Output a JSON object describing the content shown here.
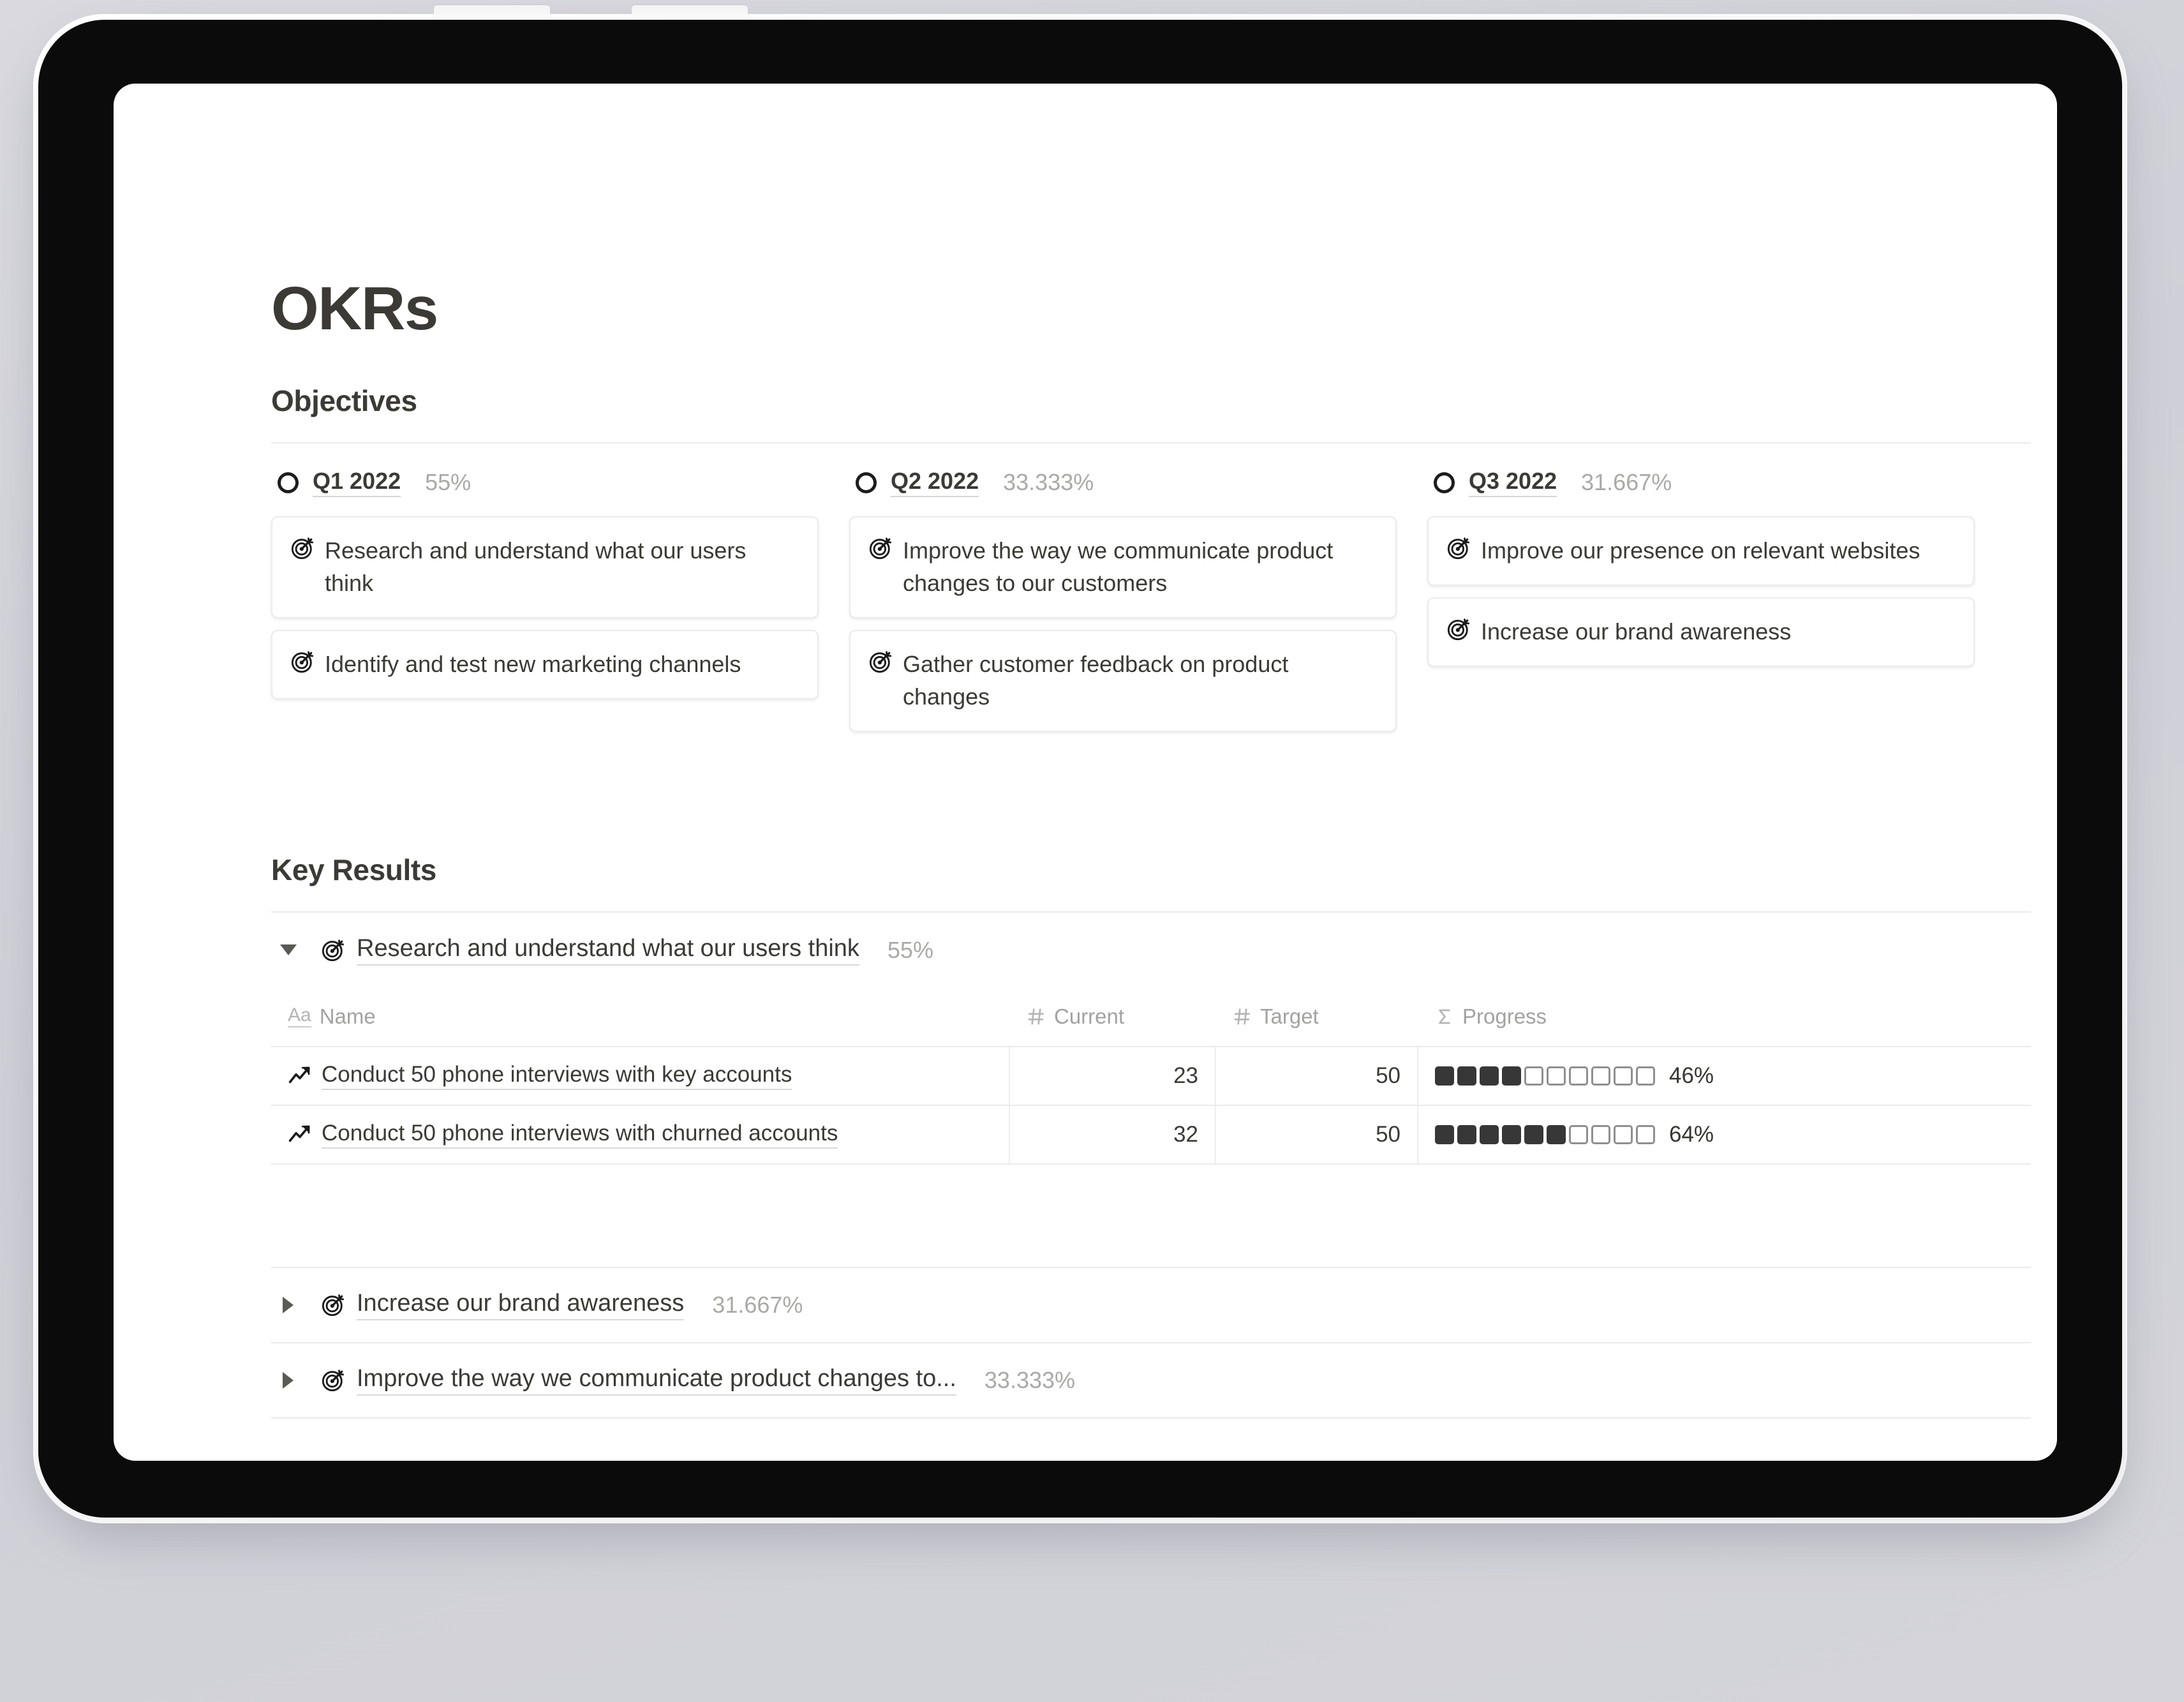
{
  "device": {
    "type": "tablet-mockup",
    "frame_color": "#f7f7f8",
    "bezel_color": "#0b0b0c",
    "screen_color": "#ffffff",
    "buttons": [
      "volume-up",
      "volume-down"
    ]
  },
  "page": {
    "title": "OKRs",
    "accent_text_color": "#3b3a35",
    "muted_text_color": "#a9a9a6",
    "divider_color": "#ebebeb"
  },
  "objectives": {
    "heading": "Objectives",
    "columns": [
      {
        "status_icon": "circle-icon",
        "name": "Q1 2022",
        "percent": "55%",
        "cards": [
          {
            "icon": "target-icon",
            "text": "Research and understand what our users think"
          },
          {
            "icon": "target-icon",
            "text": "Identify and test new marketing channels"
          }
        ]
      },
      {
        "status_icon": "circle-icon",
        "name": "Q2 2022",
        "percent": "33.333%",
        "cards": [
          {
            "icon": "target-icon",
            "text": "Improve the way we communicate product changes to our customers"
          },
          {
            "icon": "target-icon",
            "text": "Gather customer feedback on product changes"
          }
        ]
      },
      {
        "status_icon": "circle-icon",
        "name": "Q3 2022",
        "percent": "31.667%",
        "cards": [
          {
            "icon": "target-icon",
            "text": "Improve our presence on relevant websites"
          },
          {
            "icon": "target-icon",
            "text": "Increase our brand awareness"
          }
        ]
      }
    ]
  },
  "key_results": {
    "heading": "Key Results",
    "columns": [
      {
        "label": "Name",
        "type_icon": "text-type-icon"
      },
      {
        "label": "Current",
        "type_icon": "number-type-icon"
      },
      {
        "label": "Target",
        "type_icon": "number-type-icon"
      },
      {
        "label": "Progress",
        "type_icon": "formula-type-icon"
      }
    ],
    "groups": [
      {
        "expanded": true,
        "icon": "target-icon",
        "title": "Research and understand what our users think",
        "percent": "55%",
        "rows": [
          {
            "icon": "trending-up-icon",
            "name": "Conduct 50 phone interviews with key accounts",
            "current": "23",
            "target": "50",
            "progress_label": "46%",
            "progress_filled": 4,
            "progress_total": 10
          },
          {
            "icon": "trending-up-icon",
            "name": "Conduct 50 phone interviews with churned accounts",
            "current": "32",
            "target": "50",
            "progress_label": "64%",
            "progress_filled": 6,
            "progress_total": 10
          }
        ]
      },
      {
        "expanded": false,
        "icon": "target-icon",
        "title": "Increase our brand awareness",
        "percent": "31.667%",
        "rows": []
      },
      {
        "expanded": false,
        "icon": "target-icon",
        "title": "Improve the way we communicate product changes to...",
        "percent": "33.333%",
        "rows": []
      }
    ]
  }
}
